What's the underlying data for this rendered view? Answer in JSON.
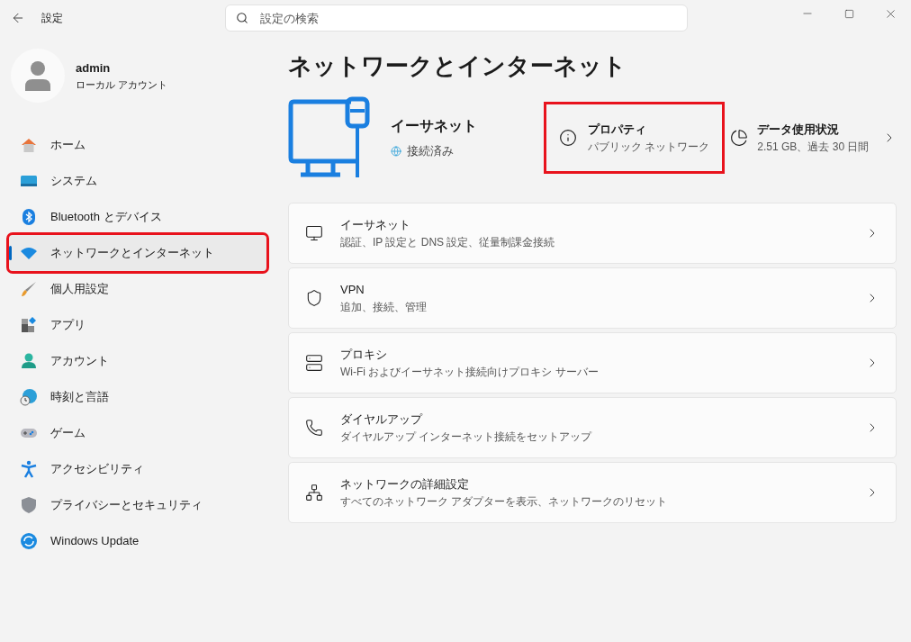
{
  "window": {
    "title": "設定",
    "search": {
      "placeholder": "設定の検索"
    }
  },
  "profile": {
    "name": "admin",
    "account": "ローカル アカウント"
  },
  "sidebar": {
    "items": [
      {
        "label": "ホーム",
        "kind": "home",
        "selected": false,
        "highlighted": false
      },
      {
        "label": "システム",
        "kind": "system",
        "selected": false,
        "highlighted": false
      },
      {
        "label": "Bluetooth とデバイス",
        "kind": "bluetooth",
        "selected": false,
        "highlighted": false
      },
      {
        "label": "ネットワークとインターネット",
        "kind": "network",
        "selected": true,
        "highlighted": true
      },
      {
        "label": "個人用設定",
        "kind": "brush",
        "selected": false,
        "highlighted": false
      },
      {
        "label": "アプリ",
        "kind": "apps",
        "selected": false,
        "highlighted": false
      },
      {
        "label": "アカウント",
        "kind": "account",
        "selected": false,
        "highlighted": false
      },
      {
        "label": "時刻と言語",
        "kind": "time",
        "selected": false,
        "highlighted": false
      },
      {
        "label": "ゲーム",
        "kind": "game",
        "selected": false,
        "highlighted": false
      },
      {
        "label": "アクセシビリティ",
        "kind": "accessibility",
        "selected": false,
        "highlighted": false
      },
      {
        "label": "プライバシーとセキュリティ",
        "kind": "privacy",
        "selected": false,
        "highlighted": false
      },
      {
        "label": "Windows Update",
        "kind": "update",
        "selected": false,
        "highlighted": false
      }
    ]
  },
  "page": {
    "title": "ネットワークとインターネット",
    "connection": {
      "name": "イーサネット",
      "status": "接続済み"
    },
    "properties": {
      "title": "プロパティ",
      "subtitle": "パブリック ネットワーク",
      "highlighted": true
    },
    "data_usage": {
      "title": "データ使用状況",
      "subtitle": "2.51 GB、過去 30 日間"
    },
    "cards": [
      {
        "kind": "ethernet",
        "title": "イーサネット",
        "subtitle": "認証、IP 設定と DNS 設定、従量制課金接続"
      },
      {
        "kind": "vpn",
        "title": "VPN",
        "subtitle": "追加、接続、管理"
      },
      {
        "kind": "proxy",
        "title": "プロキシ",
        "subtitle": "Wi-Fi およびイーサネット接続向けプロキシ サーバー"
      },
      {
        "kind": "dialup",
        "title": "ダイヤルアップ",
        "subtitle": "ダイヤルアップ インターネット接続をセットアップ"
      },
      {
        "kind": "advanced",
        "title": "ネットワークの詳細設定",
        "subtitle": "すべてのネットワーク アダプターを表示、ネットワークのリセット"
      }
    ]
  }
}
